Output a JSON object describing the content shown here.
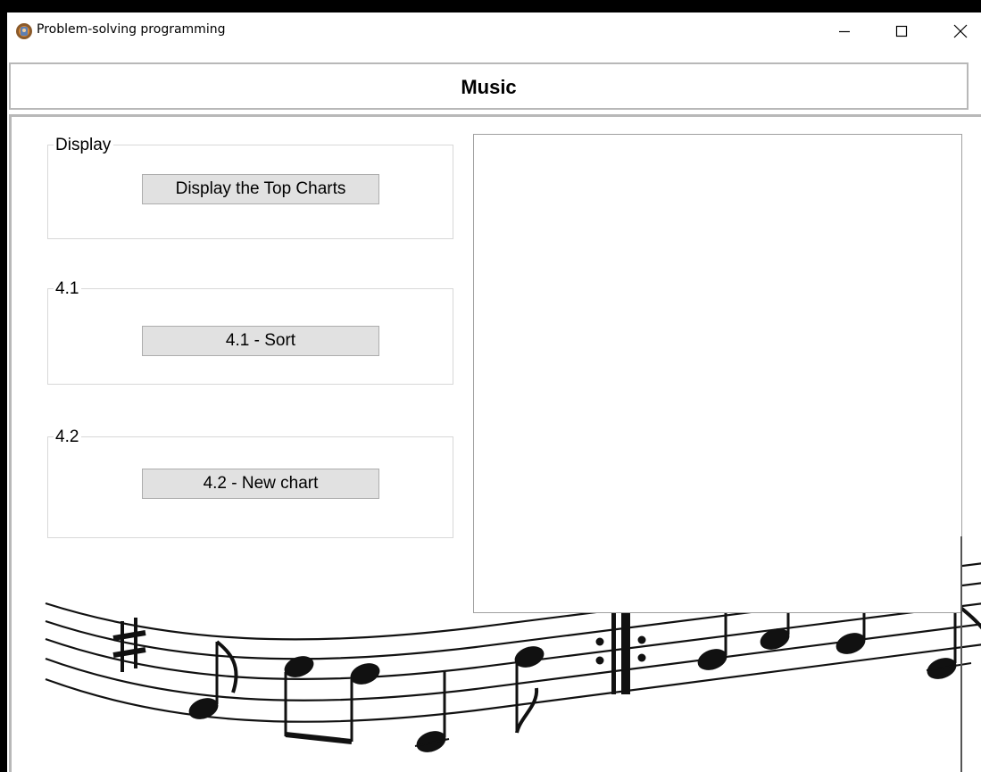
{
  "window": {
    "title": "Problem-solving programming",
    "controls": [
      "minimize-icon",
      "maximize-icon",
      "close-icon"
    ]
  },
  "header": {
    "title": "Music"
  },
  "groups": [
    {
      "legend": "Display",
      "button_label": "Display  the Top Charts"
    },
    {
      "legend": "4.1",
      "button_label": "4.1 - Sort"
    },
    {
      "legend": "4.2",
      "button_label": "4.2 - New chart"
    }
  ],
  "output": {
    "content": ""
  },
  "background": {
    "image": "music-staff-notes"
  }
}
